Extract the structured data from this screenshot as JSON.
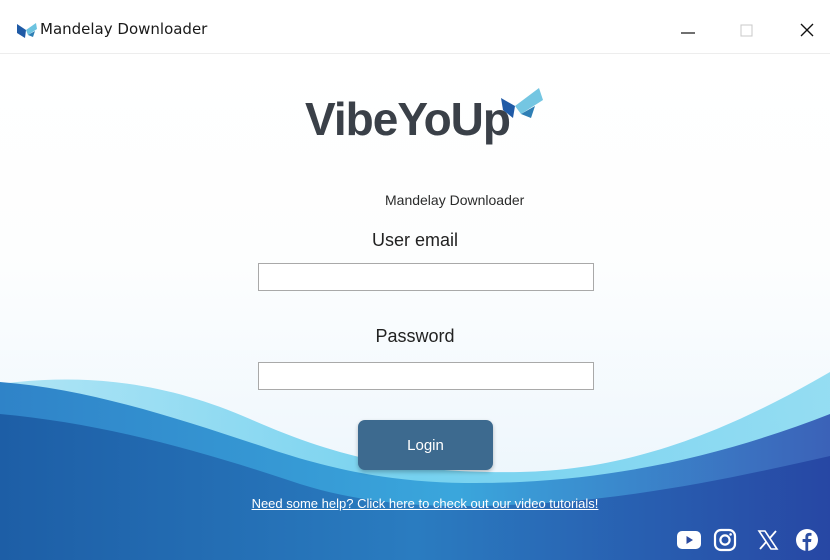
{
  "window": {
    "title": "Mandelay Downloader",
    "controls": {
      "minimize": "—",
      "maximize": "☐",
      "close": "✕"
    }
  },
  "logo": {
    "brand": "VibeYoUp",
    "subtitle": "Mandelay Downloader",
    "icon": "vibeyoup-logo-icon"
  },
  "form": {
    "email_label": "User email",
    "email_value": "",
    "email_placeholder": "",
    "password_label": "Password",
    "password_value": "",
    "password_placeholder": "",
    "login_label": "Login"
  },
  "help": {
    "link_text": "Need some help? Click here to check out our video tutorials!"
  },
  "social": [
    {
      "name": "youtube-icon"
    },
    {
      "name": "instagram-icon"
    },
    {
      "name": "x-icon"
    },
    {
      "name": "facebook-icon"
    }
  ],
  "colors": {
    "login_button": "#3d6a8f",
    "wave_dark": "#1f5aa6",
    "wave_light": "#5cc8ec",
    "logo_text": "#3a4048"
  }
}
